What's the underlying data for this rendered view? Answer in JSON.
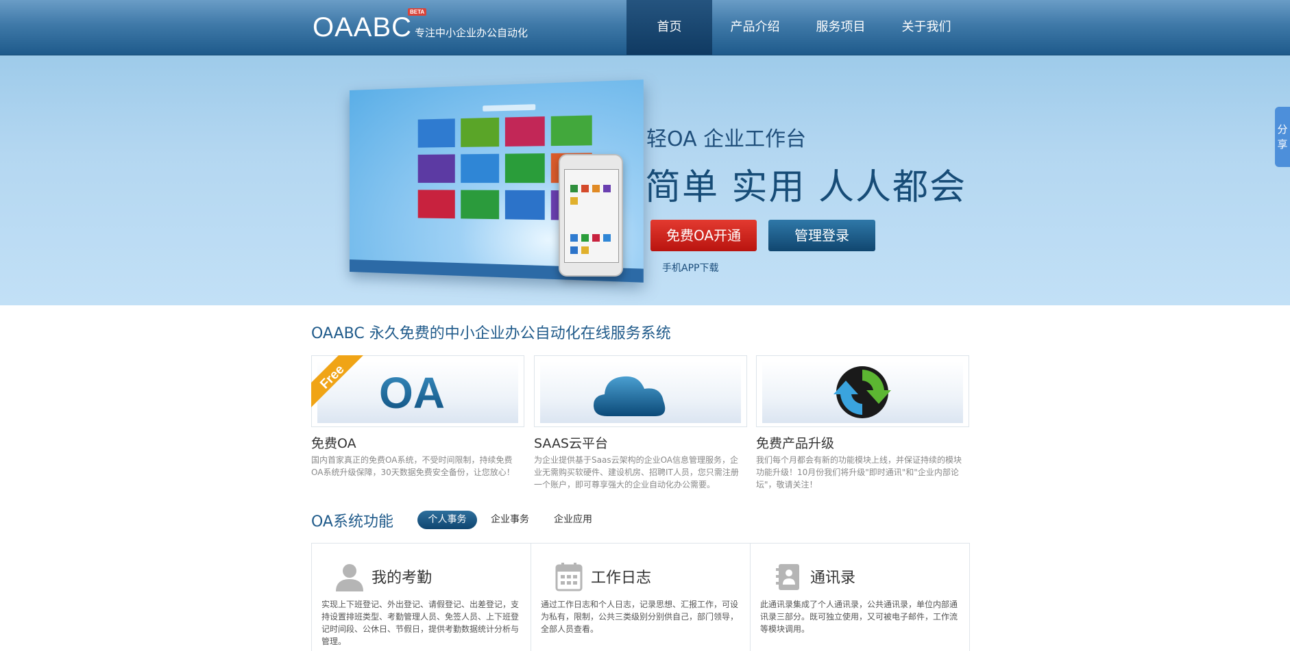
{
  "header": {
    "logo": "OAABC",
    "beta": "BETA",
    "tagline": "专注中小企业办公自动化",
    "nav": [
      "首页",
      "产品介绍",
      "服务项目",
      "关于我们"
    ],
    "active_nav": 0
  },
  "banner": {
    "subtitle": "轻OA 企业工作台",
    "title": "简单 实用 人人都会",
    "btn_free": "免费OA开通",
    "btn_login": "管理登录",
    "app_link": "手机APP下载"
  },
  "share": [
    "分",
    "享"
  ],
  "intro": {
    "title": "OAABC 永久免费的中小企业办公自动化在线服务系统",
    "cards": [
      {
        "badge": "Free",
        "image_text": "OA",
        "title": "免费OA",
        "desc": "国内首家真正的免费OA系统，不受时间限制，持续免费OA系统升级保障，30天数据免费安全备份，让您放心！"
      },
      {
        "title": "SAAS云平台",
        "desc": "为企业提供基于Saas云架构的企业OA信息管理服务，企业无需购买软硬件、建设机房、招聘IT人员，您只需注册一个账户，即可尊享强大的企业自动化办公需要。"
      },
      {
        "title": "免费产品升级",
        "desc": "我们每个月都会有新的功能模块上线，并保证持续的模块功能升级！10月份我们将升级\"即时通讯\"和\"企业内部论坛\"，敬请关注！"
      }
    ]
  },
  "functions": {
    "title": "OA系统功能",
    "tabs": [
      "个人事务",
      "企业事务",
      "企业应用"
    ],
    "active_tab": 0,
    "items": [
      {
        "icon": "user-icon",
        "title": "我的考勤",
        "desc": "实现上下班登记、外出登记、请假登记、出差登记，支持设置排班类型、考勤管理人员、免签人员、上下班登记时间段、公休日、节假日，提供考勤数据统计分析与管理。"
      },
      {
        "icon": "calendar-icon",
        "title": "工作日志",
        "desc": "通过工作日志和个人日志，记录思想、汇报工作，可设为私有，限制，公共三类级别分别供自己，部门领导，全部人员查看。"
      },
      {
        "icon": "address-book-icon",
        "title": "通讯录",
        "desc": "此通讯录集成了个人通讯录，公共通讯录，单位内部通讯录三部分。既可独立使用，又可被电子邮件，工作流等模块调用。"
      }
    ]
  },
  "colors": {
    "header_dark": "#1e5a8b",
    "accent_red": "#d32a22",
    "accent_blue": "#174c77"
  }
}
